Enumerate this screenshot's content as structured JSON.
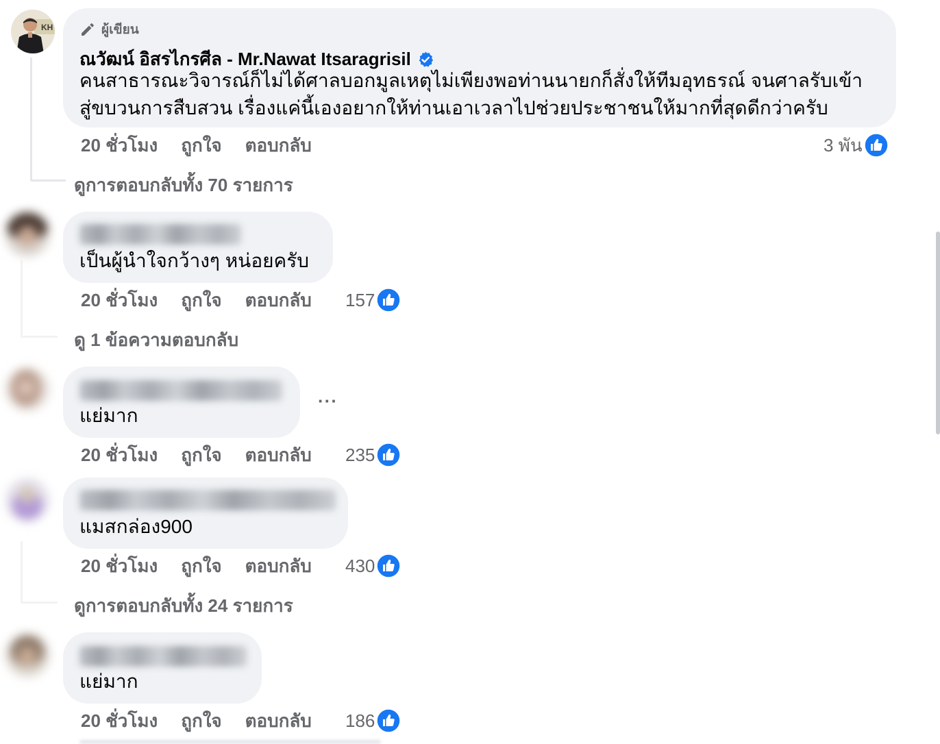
{
  "colors": {
    "bubble": "#f0f2f5",
    "secondary_text": "#65676b",
    "primary_text": "#050505",
    "like_blue": "#1877f2",
    "verified_blue": "#1877f2"
  },
  "post": {
    "author_badge_label": "ผู้เขียน",
    "author_badge_icon": "pencil-icon",
    "author_name": "ณวัฒน์ อิสรไกรศีล - Mr.Nawat Itsaragrisil",
    "verified_icon": "verified-badge-icon",
    "text_line_1": "คนสาธารณะวิจารณ์ก็ไม่ได้ศาลบอกมูลเหตุไม่เพียงพอท่านนายกก็สั่งให้ทีมอุทธรณ์ จนศาลรับเข้า",
    "text_line_2": "สู่ขบวนการสืบสวน เรื่องแค่นี้เองอยากให้ท่านเอาเวลาไปช่วยประชาชนให้มากที่สุดดีกว่าครับ",
    "time": "20 ชั่วโมง",
    "like_label": "ถูกใจ",
    "reply_label": "ตอบกลับ",
    "reaction_count": "3 พัน",
    "view_replies": "ดูการตอบกลับทั้ง 70 รายการ"
  },
  "comments": [
    {
      "text": "เป็นผู้นำใจกว้างๆ หน่อยครับ",
      "time": "20 ชั่วโมง",
      "like_label": "ถูกใจ",
      "reply_label": "ตอบกลับ",
      "reaction_count": "157",
      "view_replies": "ดู 1 ข้อความตอบกลับ"
    },
    {
      "text": "แย่มาก",
      "time": "20 ชั่วโมง",
      "like_label": "ถูกใจ",
      "reply_label": "ตอบกลับ",
      "reaction_count": "235",
      "more_label": "···"
    },
    {
      "text": "แมสกล่อง900",
      "time": "20 ชั่วโมง",
      "like_label": "ถูกใจ",
      "reply_label": "ตอบกลับ",
      "reaction_count": "430",
      "view_replies": "ดูการตอบกลับทั้ง 24 รายการ"
    },
    {
      "text": "แย่มาก",
      "time": "20 ชั่วโมง",
      "like_label": "ถูกใจ",
      "reply_label": "ตอบกลับ",
      "reaction_count": "186"
    }
  ],
  "icons": {
    "like": "thumbs-up-icon",
    "more": "more-options-icon"
  }
}
